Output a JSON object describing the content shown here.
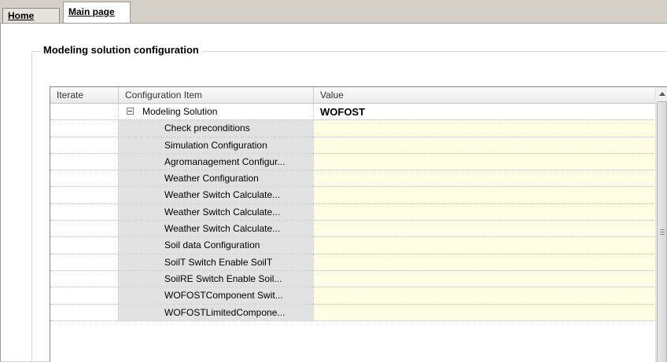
{
  "tabs": [
    {
      "label": "Home",
      "active": false
    },
    {
      "label": "Main page",
      "active": true
    }
  ],
  "group": {
    "title": "Modeling solution configuration"
  },
  "grid": {
    "columns": [
      "Iterate",
      "Configuration Item",
      "Value"
    ],
    "rows": [
      {
        "iterate": "",
        "item": "Modeling Solution",
        "value": "WOFOST",
        "expander": "collapse"
      },
      {
        "iterate": "",
        "item": "Check preconditions",
        "value": ""
      },
      {
        "iterate": "",
        "item": "Simulation Configuration",
        "value": ""
      },
      {
        "iterate": "",
        "item": "Agromanagement Configur...",
        "value": ""
      },
      {
        "iterate": "",
        "item": "Weather Configuration",
        "value": ""
      },
      {
        "iterate": "",
        "item": "Weather Switch Calculate...",
        "value": ""
      },
      {
        "iterate": "",
        "item": "Weather Switch Calculate...",
        "value": ""
      },
      {
        "iterate": "",
        "item": "Weather Switch Calculate...",
        "value": ""
      },
      {
        "iterate": "",
        "item": "Soil data Configuration",
        "value": ""
      },
      {
        "iterate": "",
        "item": "SoilT Switch Enable SoilT",
        "value": ""
      },
      {
        "iterate": "",
        "item": "SoilRE Switch Enable Soil...",
        "value": ""
      },
      {
        "iterate": "",
        "item": "WOFOSTComponent Swit...",
        "value": ""
      },
      {
        "iterate": "",
        "item": "WOFOSTLimitedCompone...",
        "value": ""
      }
    ]
  },
  "colors": {
    "value_cell": "#fffde4",
    "item_cell": "#e2e2e2"
  }
}
